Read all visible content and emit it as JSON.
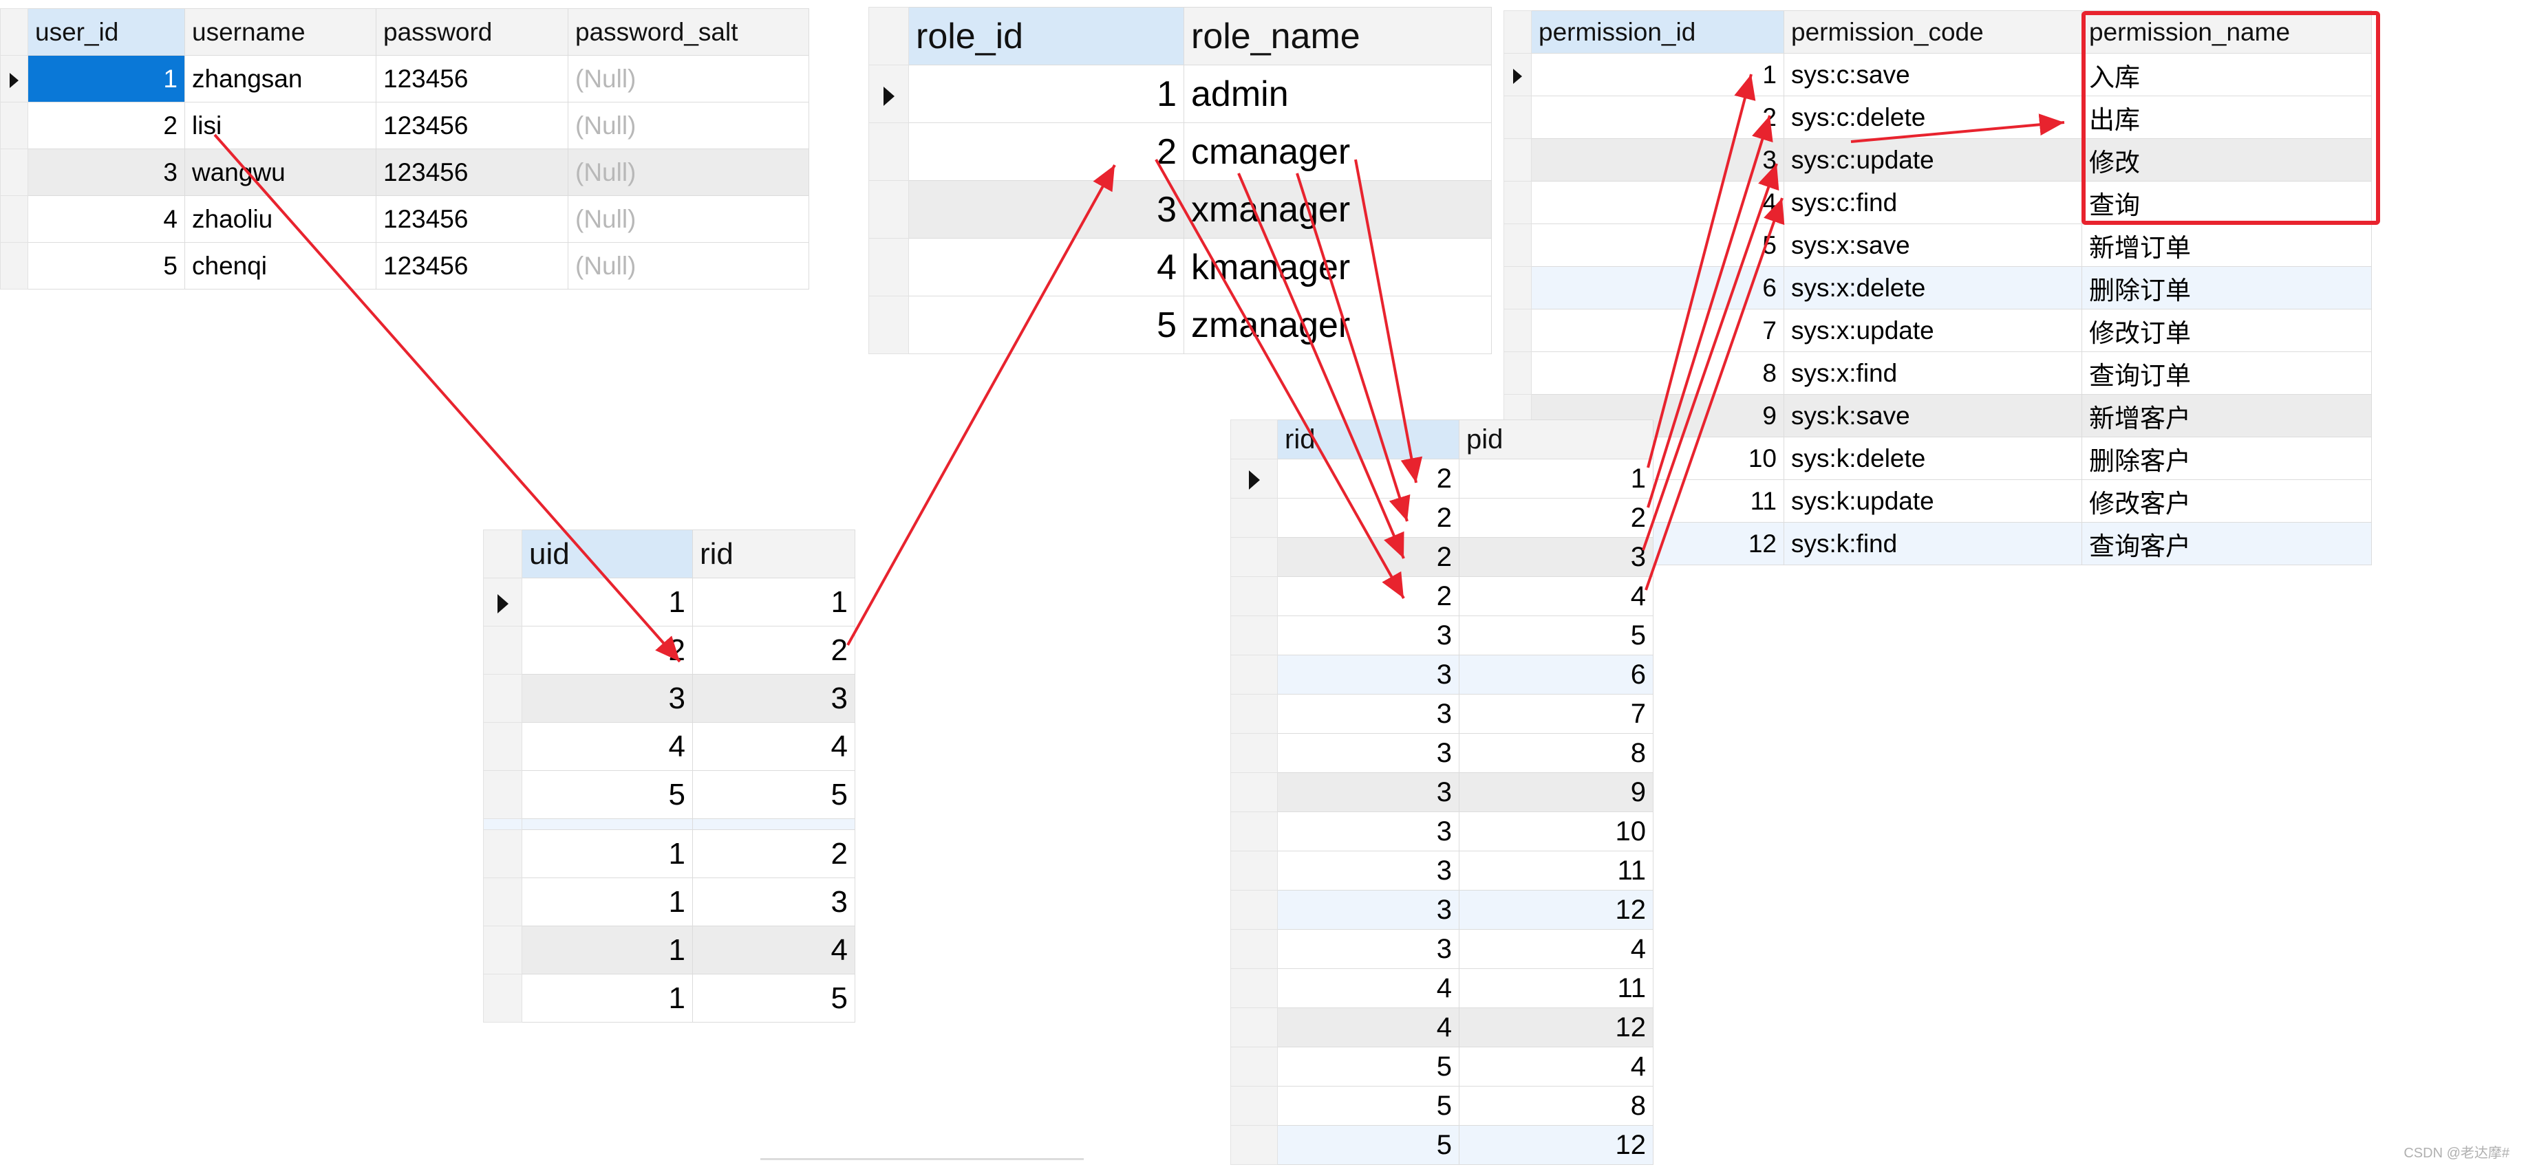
{
  "users": {
    "columns": [
      "user_id",
      "username",
      "password",
      "password_salt"
    ],
    "rows": [
      [
        "1",
        "zhangsan",
        "123456",
        "(Null)"
      ],
      [
        "2",
        "lisi",
        "123456",
        "(Null)"
      ],
      [
        "3",
        "wangwu",
        "123456",
        "(Null)"
      ],
      [
        "4",
        "zhaoliu",
        "123456",
        "(Null)"
      ],
      [
        "5",
        "chenqi",
        "123456",
        "(Null)"
      ]
    ]
  },
  "roles": {
    "columns": [
      "role_id",
      "role_name"
    ],
    "rows": [
      [
        "1",
        "admin"
      ],
      [
        "2",
        "cmanager"
      ],
      [
        "3",
        "xmanager"
      ],
      [
        "4",
        "kmanager"
      ],
      [
        "5",
        "zmanager"
      ]
    ]
  },
  "permissions": {
    "columns": [
      "permission_id",
      "permission_code",
      "permission_name"
    ],
    "rows": [
      [
        "1",
        "sys:c:save",
        "入库"
      ],
      [
        "2",
        "sys:c:delete",
        "出库"
      ],
      [
        "3",
        "sys:c:update",
        "修改"
      ],
      [
        "4",
        "sys:c:find",
        "查询"
      ],
      [
        "5",
        "sys:x:save",
        "新增订单"
      ],
      [
        "6",
        "sys:x:delete",
        "删除订单"
      ],
      [
        "7",
        "sys:x:update",
        "修改订单"
      ],
      [
        "8",
        "sys:x:find",
        "查询订单"
      ],
      [
        "9",
        "sys:k:save",
        "新增客户"
      ],
      [
        "10",
        "sys:k:delete",
        "删除客户"
      ],
      [
        "11",
        "sys:k:update",
        "修改客户"
      ],
      [
        "12",
        "sys:k:find",
        "查询客户"
      ]
    ]
  },
  "user_role": {
    "columns": [
      "uid",
      "rid"
    ],
    "rows": [
      [
        "1",
        "1"
      ],
      [
        "2",
        "2"
      ],
      [
        "3",
        "3"
      ],
      [
        "4",
        "4"
      ],
      [
        "5",
        "5"
      ],
      [
        "1",
        "2"
      ],
      [
        "1",
        "3"
      ],
      [
        "1",
        "4"
      ],
      [
        "1",
        "5"
      ]
    ]
  },
  "role_permission": {
    "columns": [
      "rid",
      "pid"
    ],
    "rows": [
      [
        "2",
        "1"
      ],
      [
        "2",
        "2"
      ],
      [
        "2",
        "3"
      ],
      [
        "2",
        "4"
      ],
      [
        "3",
        "5"
      ],
      [
        "3",
        "6"
      ],
      [
        "3",
        "7"
      ],
      [
        "3",
        "8"
      ],
      [
        "3",
        "9"
      ],
      [
        "3",
        "10"
      ],
      [
        "3",
        "11"
      ],
      [
        "3",
        "12"
      ],
      [
        "3",
        "4"
      ],
      [
        "4",
        "11"
      ],
      [
        "4",
        "12"
      ],
      [
        "5",
        "4"
      ],
      [
        "5",
        "8"
      ],
      [
        "5",
        "12"
      ]
    ]
  },
  "watermark": "CSDN @老达摩#",
  "colors": {
    "arrow": "#e8232e",
    "selected_cell": "#0a78d7",
    "header_selected": "#d7e8f8",
    "row_highlight": "#ececec",
    "row_alt": "#eef5fd",
    "null_text": "#b8b8b8"
  }
}
